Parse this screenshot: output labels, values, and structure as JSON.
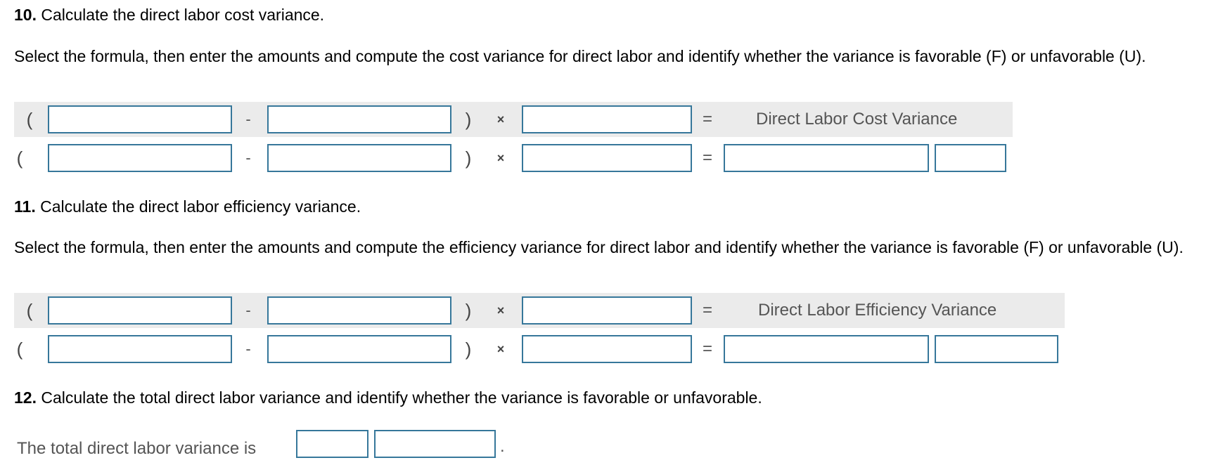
{
  "q10": {
    "number": "10.",
    "title": "Calculate the direct labor cost variance.",
    "instructions": "Select the formula, then enter the amounts and compute the cost variance for direct labor and identify whether the variance is favorable (F) or unfavorable (U).",
    "formula_row": {
      "open_paren": "(",
      "minus": "-",
      "close_paren": ")",
      "times": "×",
      "equals": "=",
      "result_label": "Direct Labor Cost Variance",
      "inputs": [
        "",
        "",
        ""
      ]
    },
    "amount_row": {
      "open_paren": "(",
      "minus": "-",
      "close_paren": ")",
      "times": "×",
      "equals": "=",
      "inputs": [
        "",
        "",
        "",
        ""
      ]
    }
  },
  "q11": {
    "number": "11.",
    "title": "Calculate the direct labor efficiency variance.",
    "instructions": "Select the formula, then enter the amounts and compute the efficiency variance for direct labor and identify whether the variance is favorable (F) or unfavorable (U).",
    "formula_row": {
      "open_paren": "(",
      "minus": "-",
      "close_paren": ")",
      "times": "×",
      "equals": "=",
      "result_label": "Direct Labor Efficiency Variance",
      "inputs": [
        "",
        "",
        ""
      ]
    },
    "amount_row": {
      "open_paren": "(",
      "minus": "-",
      "close_paren": ")",
      "times": "×",
      "equals": "=",
      "inputs": [
        "",
        "",
        "",
        ""
      ]
    }
  },
  "q12": {
    "number": "12.",
    "title": "Calculate the total direct labor variance and identify whether the variance is favorable or unfavorable.",
    "sentence_label": "The total direct labor variance is",
    "sentence_end": ".",
    "inputs": [
      "",
      ""
    ]
  },
  "colors": {
    "input_border": "#36779a",
    "formula_band": "#ebebeb",
    "label_text": "#555555"
  }
}
